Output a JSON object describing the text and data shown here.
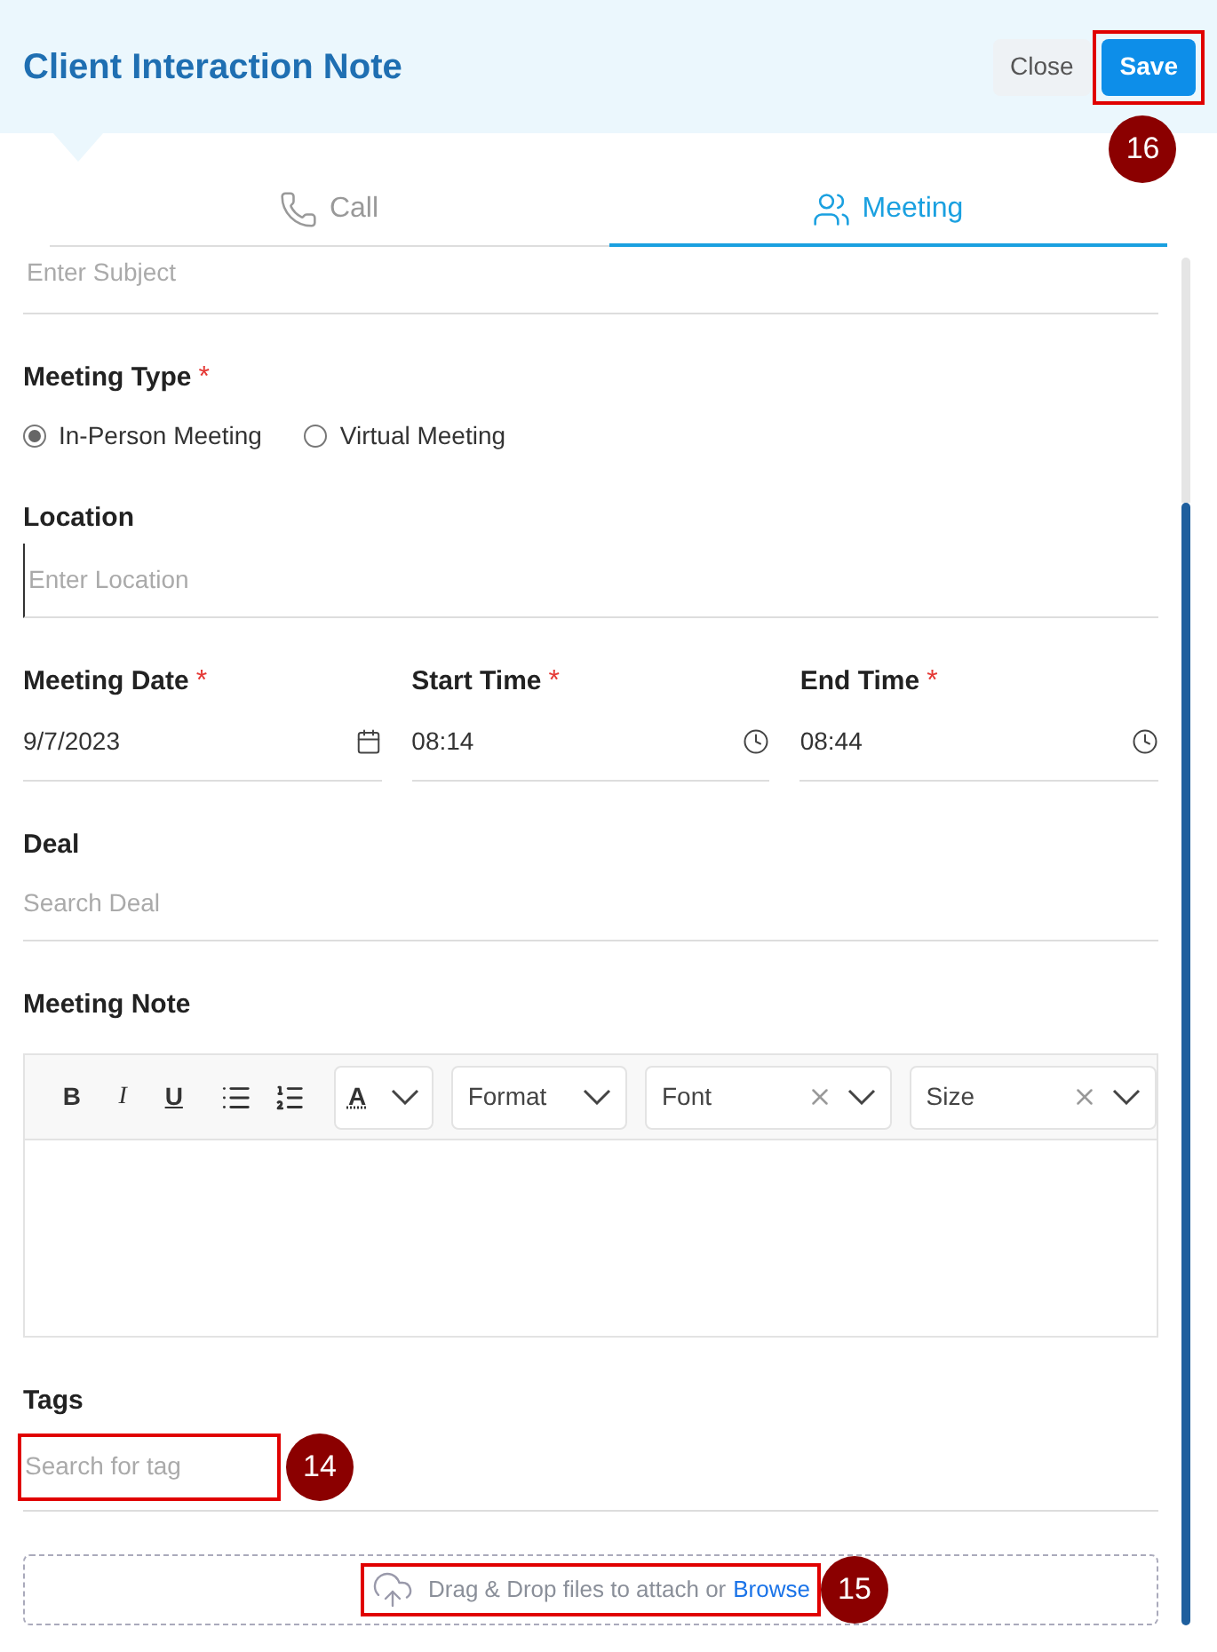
{
  "header": {
    "title": "Client Interaction Note",
    "buttons": [
      {
        "label": "Close",
        "kind": "secondary"
      },
      {
        "label": "Save",
        "kind": "primary",
        "annotation": "16"
      }
    ]
  },
  "tabs": [
    {
      "label": "Call",
      "selected": false
    },
    {
      "label": "Meeting",
      "selected": true
    }
  ],
  "subject": {
    "placeholder": "Enter Subject"
  },
  "meeting_type": {
    "label": "Meeting Type",
    "required_mark": "*",
    "options": [
      {
        "label": "In-Person Meeting",
        "selected": true
      },
      {
        "label": "Virtual Meeting",
        "selected": false
      }
    ]
  },
  "location": {
    "label": "Location",
    "placeholder": "Enter Location"
  },
  "datetime_fields": [
    {
      "label": "Meeting Date",
      "required_mark": "*",
      "value": "9/7/2023"
    },
    {
      "label": "Start Time",
      "required_mark": "*",
      "value": "08:14"
    },
    {
      "label": "End Time",
      "required_mark": "*",
      "value": "08:44"
    }
  ],
  "deal": {
    "label": "Deal",
    "placeholder": "Search Deal"
  },
  "meeting_note": {
    "label": "Meeting Note",
    "toolbar": {
      "text_buttons": [
        {
          "label": "B",
          "kind": "bold"
        },
        {
          "label": "I",
          "kind": "italic"
        },
        {
          "label": "U",
          "kind": "underline"
        }
      ],
      "color_letter": "A",
      "dropdowns": [
        {
          "label": "Format",
          "clearable": false
        },
        {
          "label": "Font",
          "clearable": true
        },
        {
          "label": "Size",
          "clearable": true
        }
      ]
    }
  },
  "tags": {
    "label": "Tags",
    "placeholder": "Search for tag",
    "annotation": "14"
  },
  "dropzone": {
    "text": "Drag & Drop files to attach or",
    "link": "Browse",
    "annotation": "15"
  }
}
